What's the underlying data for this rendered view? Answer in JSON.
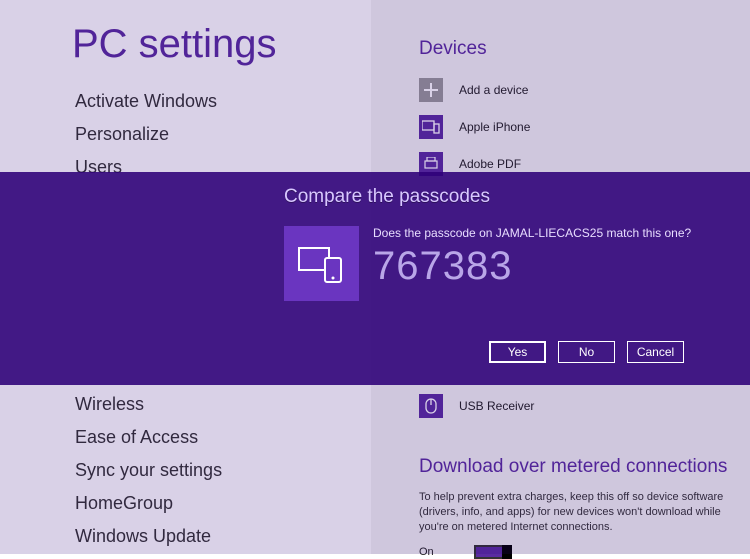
{
  "pageTitle": "PC settings",
  "nav": {
    "items": [
      "Activate Windows",
      "Personalize",
      "Users",
      "",
      "",
      "",
      "",
      "",
      "",
      "Wireless",
      "Ease of Access",
      "Sync your settings",
      "HomeGroup",
      "Windows Update"
    ]
  },
  "devices": {
    "title": "Devices",
    "items": [
      {
        "label": "Add a device",
        "icon": "plus"
      },
      {
        "label": "Apple iPhone",
        "icon": "device"
      },
      {
        "label": "Adobe PDF",
        "icon": "device"
      },
      {
        "label": "USB Receiver",
        "icon": "mouse"
      }
    ]
  },
  "metered": {
    "title": "Download over metered connections",
    "help": "To help prevent extra charges, keep this off so device software (drivers, info, and apps) for new devices won't download while you're on metered Internet connections.",
    "stateLabel": "On"
  },
  "dialog": {
    "title": "Compare the passcodes",
    "question": "Does the passcode on JAMAL-LIECACS25 match this one?",
    "passcode": "767383",
    "yes": "Yes",
    "no": "No",
    "cancel": "Cancel"
  }
}
